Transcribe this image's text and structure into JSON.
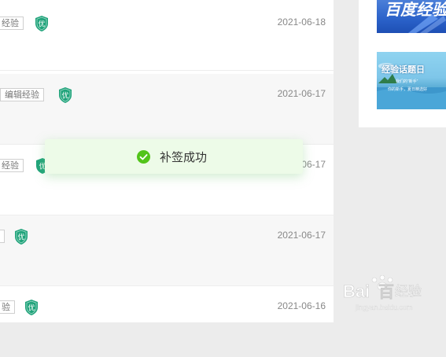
{
  "list": {
    "rows": [
      {
        "tag": "经验",
        "date": "2021-06-18"
      },
      {
        "tag": "编辑经验",
        "date": "2021-06-17"
      },
      {
        "tag": "经验",
        "date": "06-17"
      },
      {
        "tag": "",
        "date": "2021-06-17"
      },
      {
        "tag": "验",
        "date": "2021-06-16"
      }
    ],
    "badge_label": "优"
  },
  "sidebar": {
    "thumb1_text": "百度经验",
    "thumb2_text": "经验话题日",
    "thumb2_sub1": "我们的“新手”",
    "thumb2_sub2": "你的新手，夏日精选好"
  },
  "toast": {
    "icon": "check-circle-icon",
    "message": "补签成功"
  },
  "watermark": {
    "brand_text": "Bai",
    "brand_text2": "百",
    "suffix": "经验",
    "url": "jingyan.baidu.com"
  },
  "colors": {
    "badge": "#1fa37a",
    "toast_bg": "#edfbe8",
    "toast_check": "#52c41a"
  }
}
